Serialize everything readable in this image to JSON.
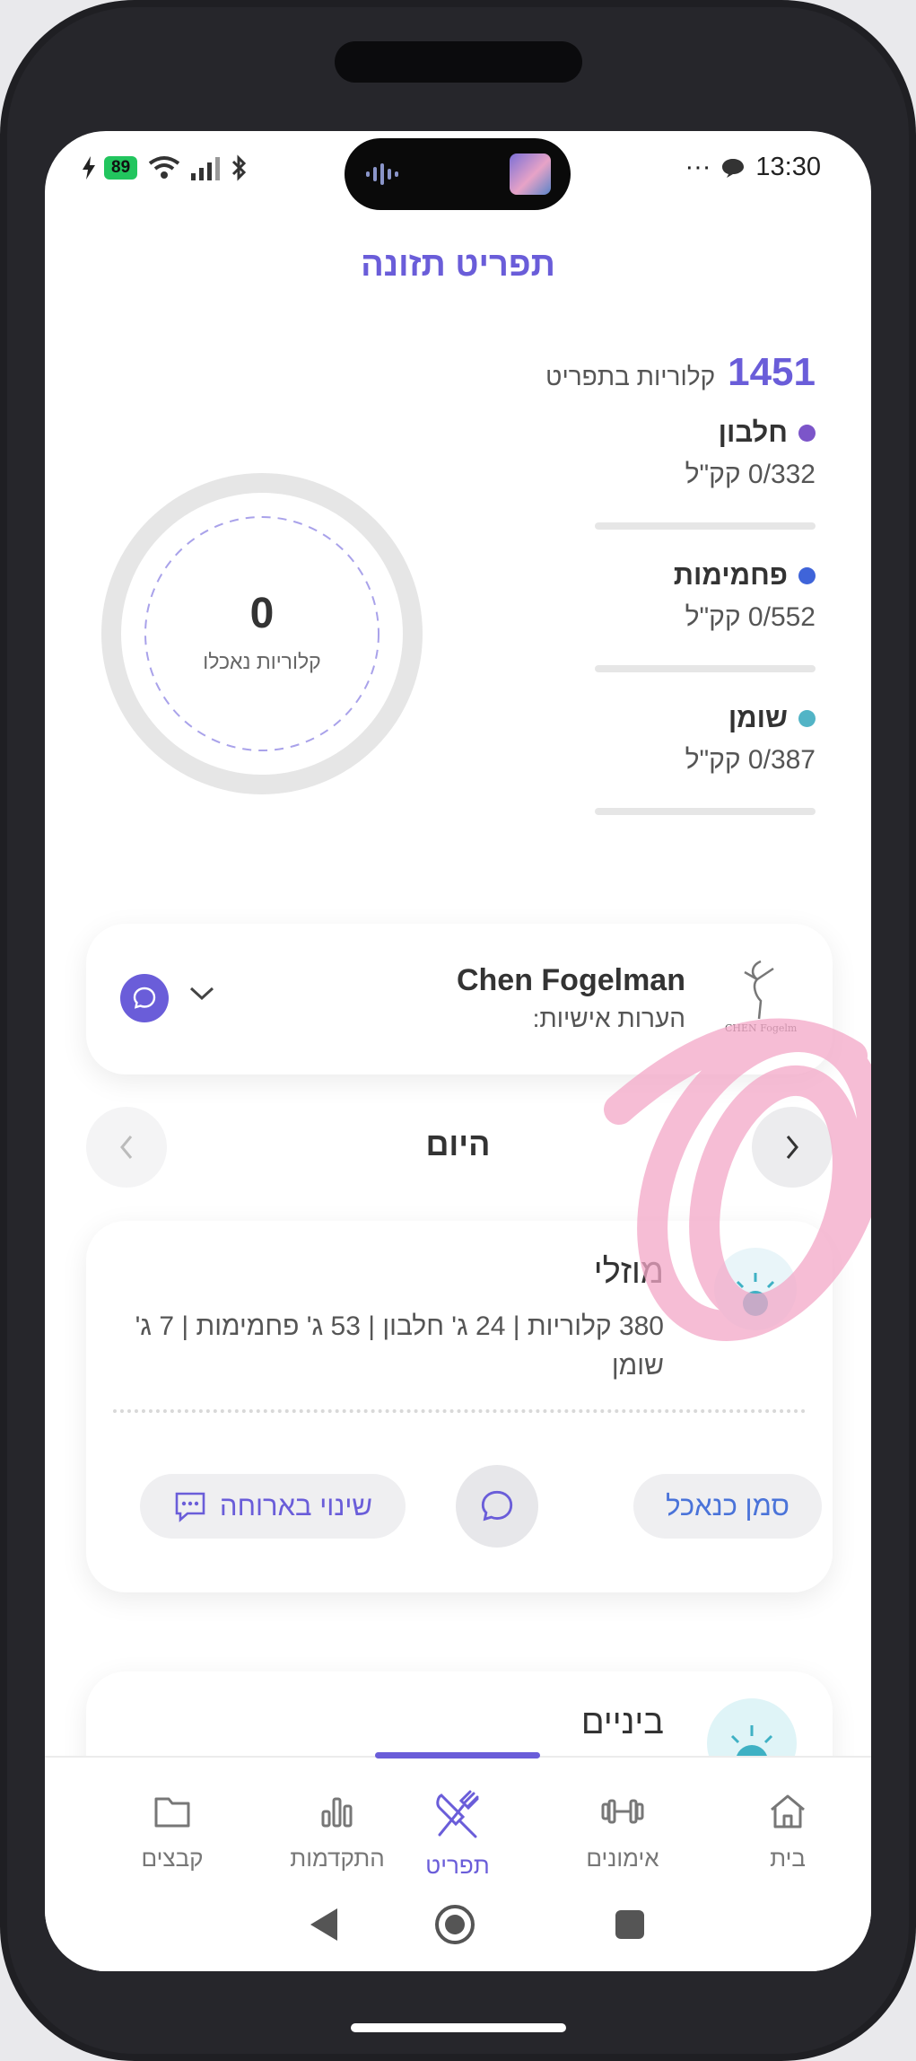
{
  "status_bar": {
    "battery": "89",
    "time": "13:30",
    "more": "···"
  },
  "header": {
    "title": "תפריט תזונה"
  },
  "summary": {
    "calories_total": "1451",
    "calories_label": "קלוריות בתפריט",
    "eaten_value": "0",
    "eaten_label": "קלוריות נאכלו",
    "macros": [
      {
        "name": "חלבון",
        "value": "0/332 קק\"ל",
        "color": "#7c55c9",
        "progress": 0
      },
      {
        "name": "פחמימות",
        "value": "0/552 קק\"ל",
        "color": "#3f64d9",
        "progress": 0
      },
      {
        "name": "שומן",
        "value": "0/387 קק\"ל",
        "color": "#52b4c6",
        "progress": 0
      }
    ]
  },
  "coach": {
    "name": "Chen Fogelman",
    "notes_label": "הערות אישיות:",
    "logo_text": "CHEN Fogelman"
  },
  "day_nav": {
    "label": "היום"
  },
  "meals": [
    {
      "title": "מוזלי",
      "description": "380 קלוריות | 24 ג' חלבון | 53 ג' פחמימות | 7 ג' שומן",
      "mark_eaten": "סמן כנאכל",
      "change_meal": "שינוי בארוחה"
    },
    {
      "title": "ביניים"
    }
  ],
  "bottom_nav": {
    "tabs": [
      {
        "label": "קבצים",
        "icon": "folder-icon"
      },
      {
        "label": "התקדמות",
        "icon": "bar-chart-icon"
      },
      {
        "label": "תפריט",
        "icon": "utensils-icon",
        "active": true
      },
      {
        "label": "אימונים",
        "icon": "dumbbell-icon"
      },
      {
        "label": "בית",
        "icon": "home-icon"
      }
    ]
  },
  "colors": {
    "accent": "#6a5dd9",
    "link": "#4a73d9"
  }
}
